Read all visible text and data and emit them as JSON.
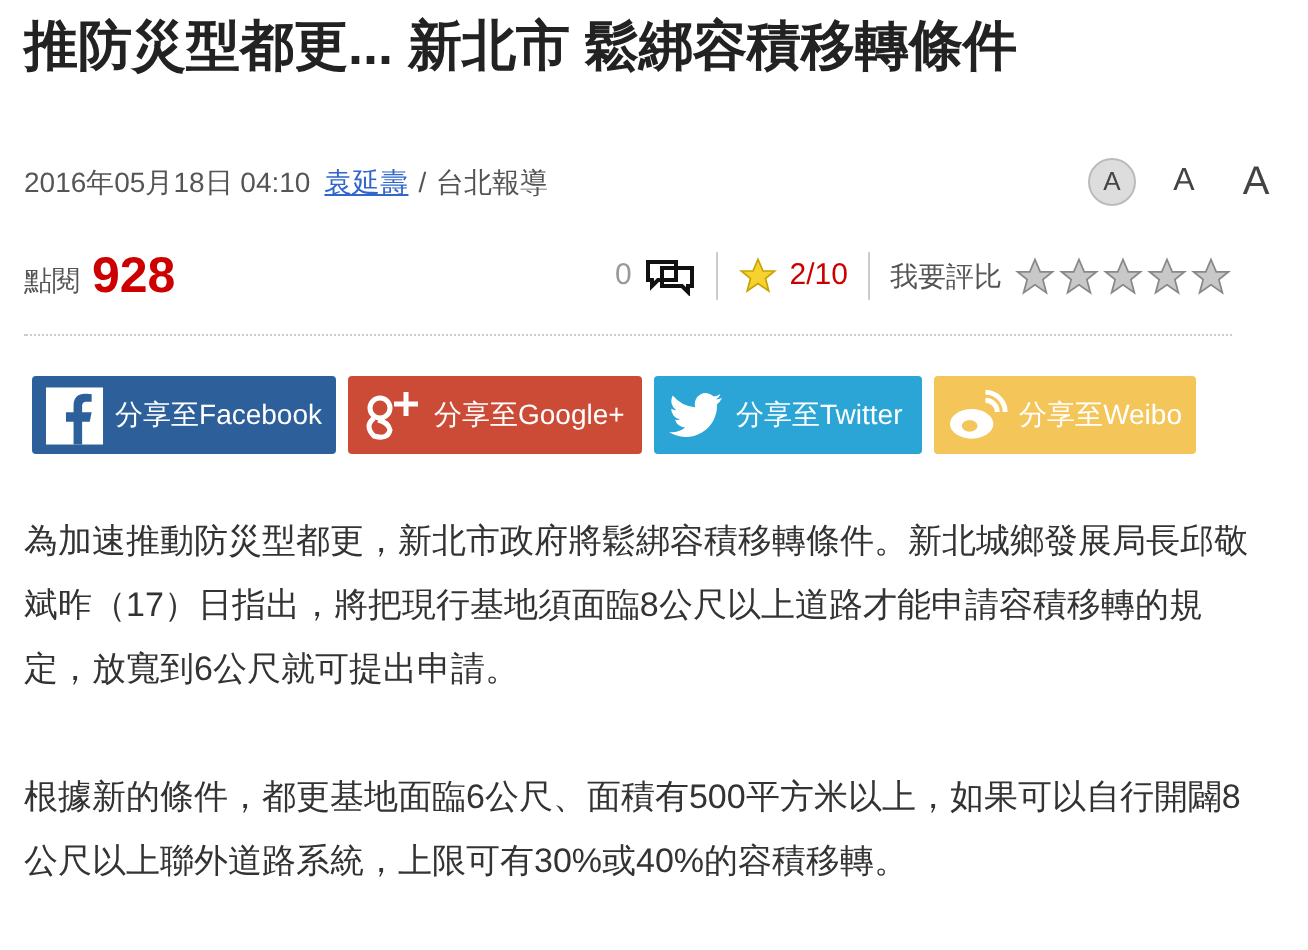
{
  "headline": "推防災型都更... 新北市 鬆綁容積移轉條件",
  "byline": {
    "datetime": "2016年05月18日 04:10",
    "author": "袁延壽",
    "separator": "/",
    "desk": "台北報導"
  },
  "font_sizes": [
    {
      "label": "A",
      "kind": "small",
      "selected": true
    },
    {
      "label": "A",
      "kind": "medium",
      "selected": false
    },
    {
      "label": "A",
      "kind": "large",
      "selected": false
    }
  ],
  "stats": {
    "views_label": "點閱",
    "views": "928",
    "comments": "0",
    "rating": "2/10",
    "rate_label": "我要評比",
    "stars": 0
  },
  "share": [
    {
      "kind": "facebook",
      "label": "分享至Facebook"
    },
    {
      "kind": "google",
      "label": "分享至Google+"
    },
    {
      "kind": "twitter",
      "label": "分享至Twitter"
    },
    {
      "kind": "weibo",
      "label": "分享至Weibo"
    }
  ],
  "paragraphs": [
    "為加速推動防災型都更，新北市政府將鬆綁容積移轉條件。新北城鄉發展局長邱敬斌昨（17）日指出，將把現行基地須面臨8公尺以上道路才能申請容積移轉的規定，放寬到6公尺就可提出申請。",
    "根據新的條件，都更基地面臨6公尺、面積有500平方米以上，如果可以自行開闢8公尺以上聯外道路系統，上限可有30%或40%的容積移轉。"
  ]
}
